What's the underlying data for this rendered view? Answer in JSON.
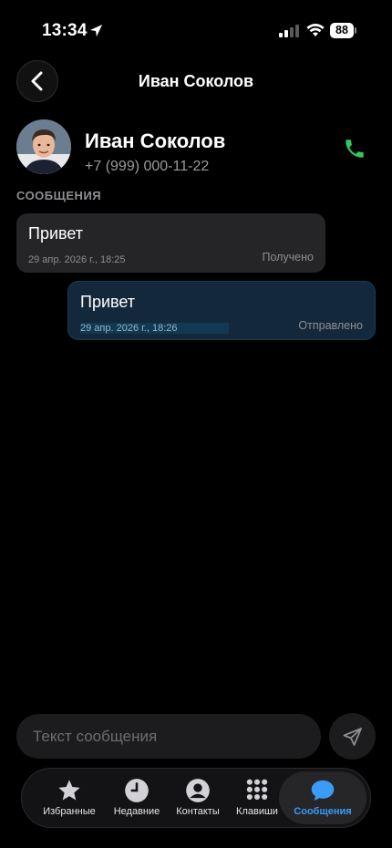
{
  "status_bar": {
    "time": "13:34",
    "battery": "88",
    "icons": [
      "location-arrow-icon",
      "cellular-signal-icon",
      "wifi-icon",
      "battery-icon"
    ]
  },
  "header": {
    "title": "Иван Соколов",
    "back_icon": "chevron-left-icon"
  },
  "contact": {
    "name": "Иван Соколов",
    "phone": "+7 (999) 000-11-22",
    "call_icon": "phone-icon",
    "call_color": "#34c759"
  },
  "messages_section": {
    "label": "СООБЩЕНИЯ"
  },
  "messages": [
    {
      "text": "Привет",
      "date": "29 апр. 2026 г., 18:25",
      "status": "Получено",
      "direction": "incoming"
    },
    {
      "text": "Привет",
      "date": "29 апр. 2026 г., 18:26",
      "status": "Отправлено",
      "direction": "outgoing"
    }
  ],
  "composer": {
    "placeholder": "Текст сообщения",
    "value": "",
    "send_icon": "paper-plane-icon"
  },
  "tab_bar": {
    "tabs": [
      {
        "label": "Избранные",
        "icon": "star-icon",
        "active": false
      },
      {
        "label": "Недавние",
        "icon": "clock-icon",
        "active": false
      },
      {
        "label": "Контакты",
        "icon": "person-circle-icon",
        "active": false
      },
      {
        "label": "Клавиши",
        "icon": "keypad-icon",
        "active": false
      },
      {
        "label": "Сообщения",
        "icon": "message-bubble-icon",
        "active": true
      }
    ],
    "accent_color": "#3a9cf5"
  }
}
